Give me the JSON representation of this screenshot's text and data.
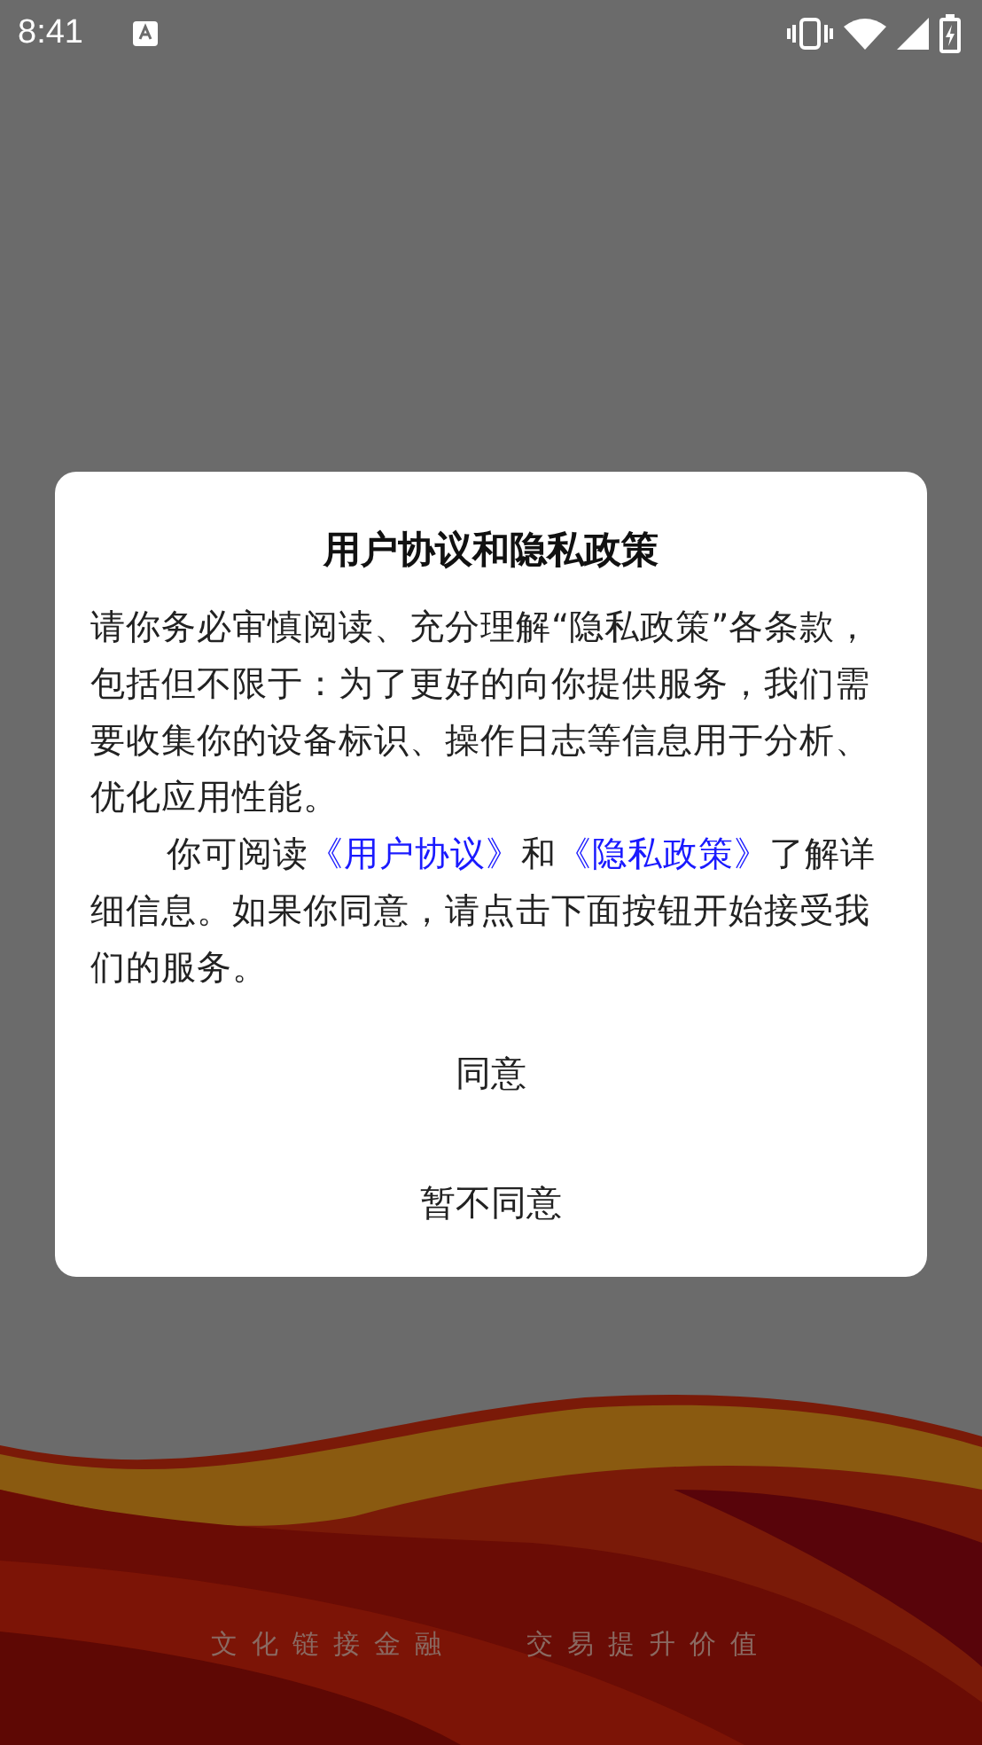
{
  "status_bar": {
    "time": "8:41"
  },
  "dialog": {
    "title": "用户协议和隐私政策",
    "paragraph_1": "请你务必审慎阅读、充分理解“隐私政策”各条款，包括但不限于：为了更好的向你提供服务，我们需要收集你的设备标识、操作日志等信息用于分析、优化应用性能。",
    "paragraph_2": [
      {
        "kind": "text",
        "text": "你可阅读"
      },
      {
        "kind": "link",
        "text": "《用户协议》"
      },
      {
        "kind": "text",
        "text": "和"
      },
      {
        "kind": "link",
        "text": "《隐私政策》"
      },
      {
        "kind": "text",
        "text": "了解详细信息。如果你同意，请点击下面按钮开始接受我们的服务。"
      }
    ],
    "buttons": [
      "同意",
      "暂不同意"
    ]
  },
  "background": {
    "kind": "picture",
    "slogan": [
      "文化链接金融",
      "交易提升价值"
    ]
  }
}
